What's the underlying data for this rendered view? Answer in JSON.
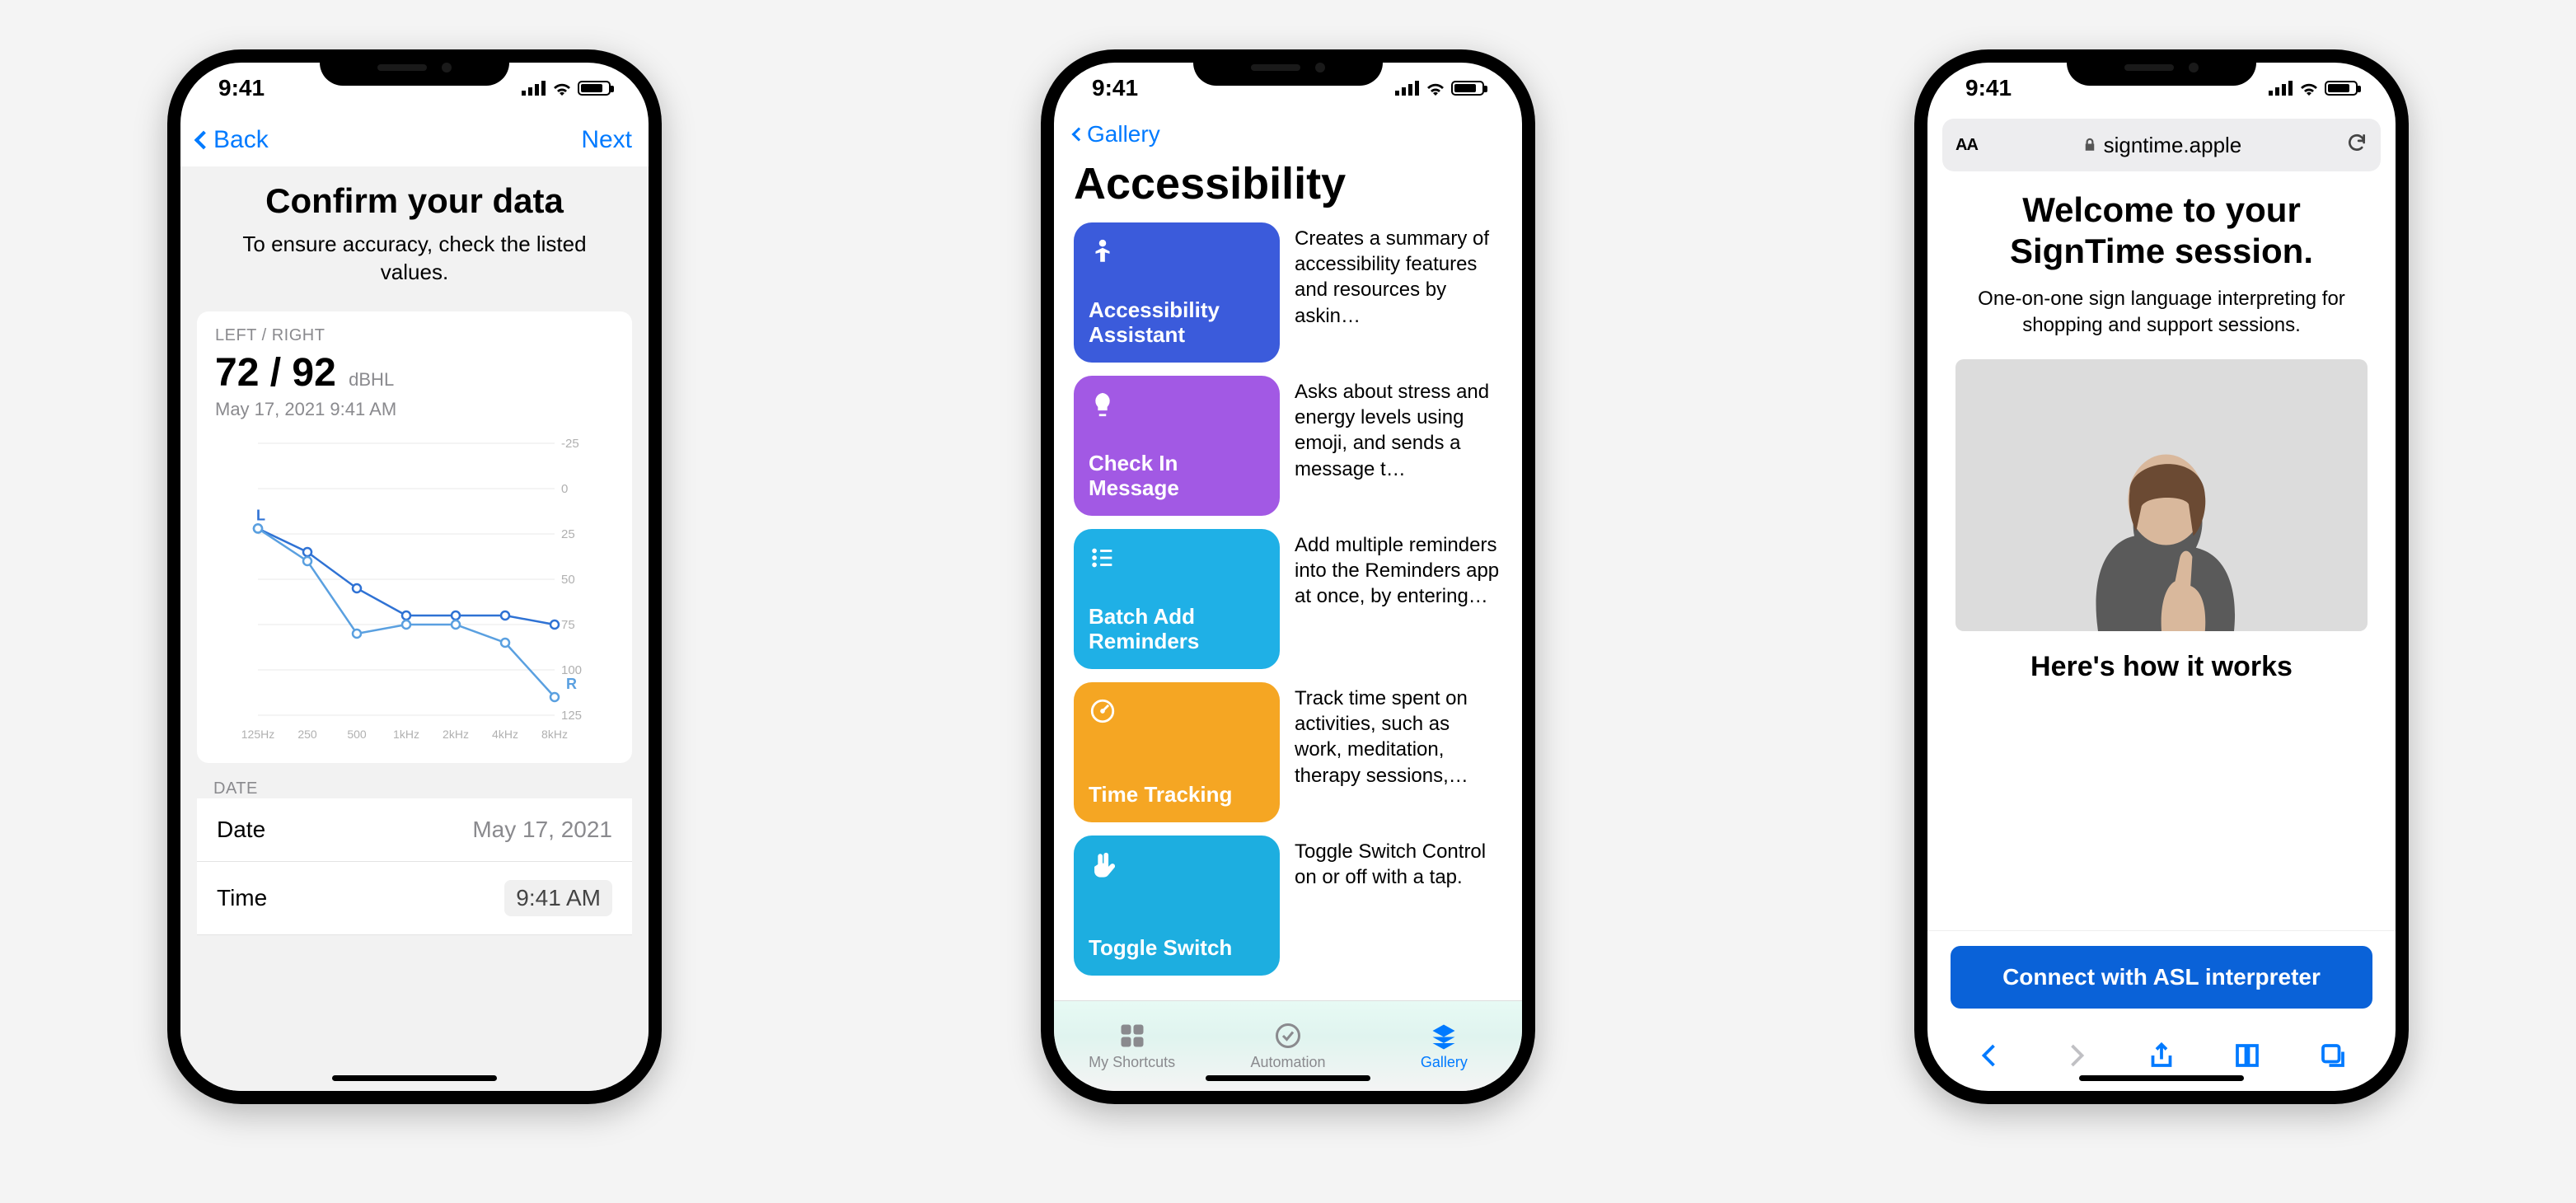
{
  "status_time": "9:41",
  "phone1": {
    "back_label": "Back",
    "next_label": "Next",
    "title": "Confirm your data",
    "subtitle": "To ensure accuracy, check the listed values.",
    "metric_label": "LEFT / RIGHT",
    "metric_value": "72 / 92",
    "metric_unit": "dBHL",
    "timestamp": "May 17, 2021  9:41 AM",
    "section_label": "DATE",
    "rows": [
      {
        "k": "Date",
        "v": "May 17, 2021"
      },
      {
        "k": "Time",
        "v": "9:41 AM"
      }
    ]
  },
  "chart_data": {
    "type": "line",
    "title": "",
    "xlabel": "",
    "ylabel": "",
    "ylim": [
      -25,
      125
    ],
    "y_ticks": [
      -25,
      0,
      25,
      50,
      75,
      100,
      125
    ],
    "categories": [
      "125Hz",
      "250",
      "500",
      "1kHz",
      "2kHz",
      "4kHz",
      "8kHz"
    ],
    "series": [
      {
        "name": "L",
        "values": [
          22,
          35,
          55,
          70,
          70,
          70,
          75
        ]
      },
      {
        "name": "R",
        "values": [
          22,
          40,
          80,
          75,
          75,
          85,
          115
        ]
      }
    ]
  },
  "phone2": {
    "breadcrumb": "Gallery",
    "title": "Accessibility",
    "shortcuts": [
      {
        "color": "#3b5bdb",
        "title": "Accessibility Assistant",
        "icon": "person",
        "desc": "Creates a summary of accessibility features and resources by askin…"
      },
      {
        "color": "#a259e4",
        "title": "Check In Message",
        "icon": "bulb",
        "desc": "Asks about stress and energy levels using emoji, and sends a message t…"
      },
      {
        "color": "#1fb0e6",
        "title": "Batch Add Reminders",
        "icon": "list",
        "desc": "Add multiple reminders into the Reminders app at once, by entering…"
      },
      {
        "color": "#f5a623",
        "title": "Time Tracking",
        "icon": "gauge",
        "desc": "Track time spent on activities, such as work, meditation, therapy sessions,…"
      },
      {
        "color": "#1daee0",
        "title": "Toggle Switch",
        "icon": "hand",
        "desc": "Toggle Switch Control on or off with a tap."
      }
    ],
    "tabs": [
      {
        "label": "My Shortcuts",
        "icon": "grid"
      },
      {
        "label": "Automation",
        "icon": "check"
      },
      {
        "label": "Gallery",
        "icon": "stack",
        "active": true
      }
    ]
  },
  "phone3": {
    "aa": "AA",
    "url": "signtime.apple",
    "heading": "Welcome to your SignTime session.",
    "subtitle": "One-on-one sign language interpreting for shopping and support sessions.",
    "how_heading": "Here's how it works",
    "cta": "Connect with ASL interpreter"
  }
}
